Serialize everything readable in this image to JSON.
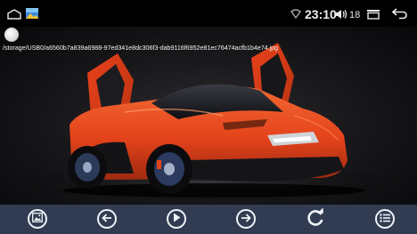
{
  "status_bar": {
    "icons": [
      "home-icon",
      "gallery-icon",
      "wifi-icon",
      "volume-icon",
      "recents-icon",
      "back-icon"
    ],
    "time": "23:10",
    "volume_level": "18"
  },
  "viewer": {
    "file_path": "/storage/USB0/a6560b7a839a6988-97ed341e8dc306f3-dab9116f6952e81ec76474acfb1b4e74.jpg",
    "image_subject": "orange sports car with doors open"
  },
  "toolbar": {
    "buttons": [
      {
        "name": "slideshow-button",
        "icon": "image-gallery-icon"
      },
      {
        "name": "previous-button",
        "icon": "arrow-left-icon"
      },
      {
        "name": "play-button",
        "icon": "play-icon"
      },
      {
        "name": "next-button",
        "icon": "arrow-right-icon"
      },
      {
        "name": "rotate-button",
        "icon": "rotate-icon"
      },
      {
        "name": "menu-button",
        "icon": "list-icon"
      }
    ]
  },
  "colors": {
    "status_bar": "#000000",
    "toolbar": "#313c52",
    "accent_orange": "#e5431b"
  }
}
